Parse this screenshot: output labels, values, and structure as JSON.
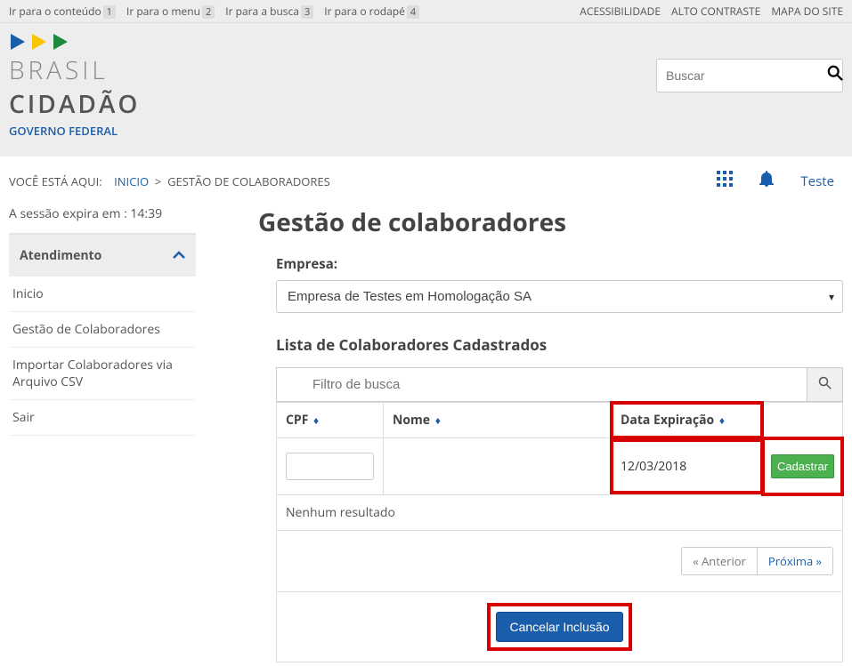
{
  "topbar": {
    "skip": [
      {
        "label": "Ir para o conteúdo",
        "key": "1"
      },
      {
        "label": "Ir para o menu",
        "key": "2"
      },
      {
        "label": "Ir para a busca",
        "key": "3"
      },
      {
        "label": "Ir para o rodapé",
        "key": "4"
      }
    ],
    "right": [
      "ACESSIBILIDADE",
      "ALTO CONTRASTE",
      "MAPA DO SITE"
    ]
  },
  "brand": {
    "brasil": "BRASIL",
    "cidadao": "CIDADÃO",
    "gov": "GOVERNO FEDERAL"
  },
  "search": {
    "placeholder": "Buscar"
  },
  "breadcrumb": {
    "prefix": "VOCÊ ESTÁ AQUI:",
    "home": "INICIO",
    "sep": ">",
    "current": "GESTÃO DE COLABORADORES"
  },
  "user": {
    "name": "Teste"
  },
  "session": {
    "label": "A sessão expira em : 14:39"
  },
  "sidebar": {
    "header": "Atendimento",
    "items": [
      "Inicio",
      "Gestão de Colaboradores",
      "Importar Colaboradores via Arquivo CSV",
      "Sair"
    ]
  },
  "page": {
    "title": "Gestão de colaboradores",
    "empresa_label": "Empresa:",
    "empresa_value": "Empresa de Testes em Homologação SA",
    "list_header": "Lista de Colaboradores Cadastrados",
    "filter_placeholder": "Filtro de busca",
    "columns": {
      "cpf": "CPF",
      "nome": "Nome",
      "data": "Data Expiração"
    },
    "row": {
      "data": "12/03/2018",
      "cadastrar": "Cadastrar"
    },
    "no_result": "Nenhum resultado",
    "pager": {
      "prev": "« Anterior",
      "next": "Próxima »"
    },
    "cancel": "Cancelar Inclusão"
  }
}
